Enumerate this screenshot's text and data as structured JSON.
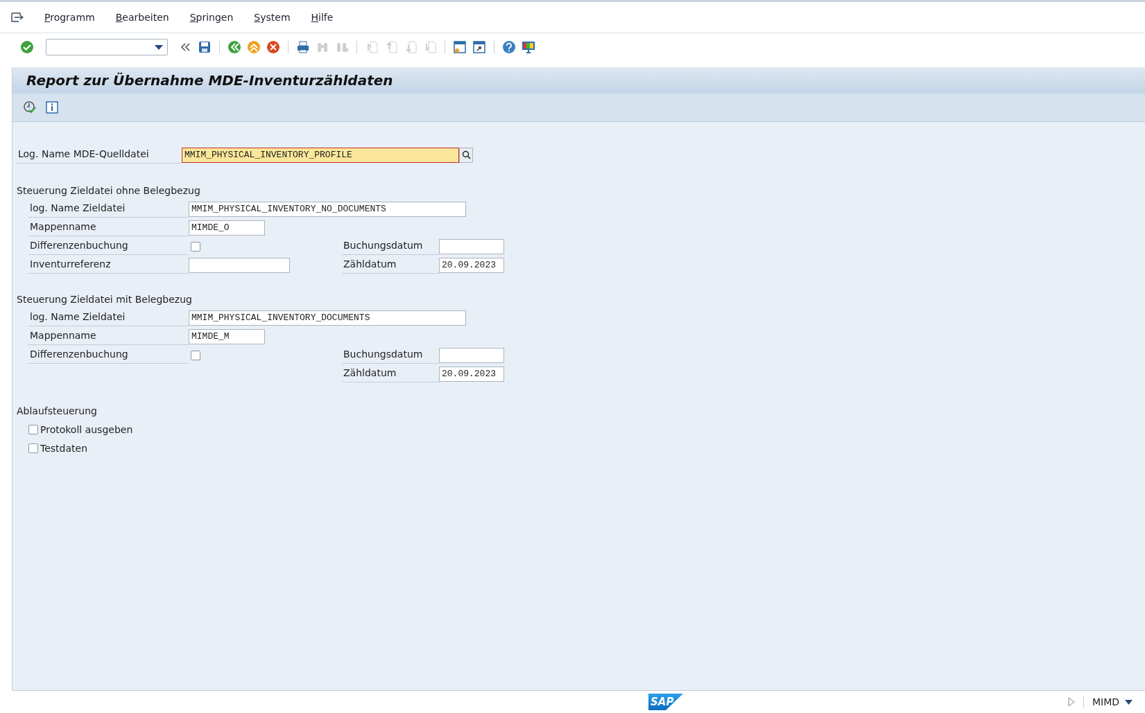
{
  "menu": [
    {
      "label": "Programm"
    },
    {
      "label": "Bearbeiten"
    },
    {
      "label": "Springen"
    },
    {
      "label": "System"
    },
    {
      "label": "Hilfe"
    }
  ],
  "toolbar": [
    {
      "kind": "enter",
      "disabled": false
    },
    {
      "kind": "command"
    },
    {
      "kind": "collapse",
      "disabled": false
    },
    {
      "kind": "save",
      "disabled": false
    },
    {
      "kind": "sep"
    },
    {
      "kind": "back",
      "disabled": false
    },
    {
      "kind": "exit",
      "disabled": false
    },
    {
      "kind": "cancel",
      "disabled": false
    },
    {
      "kind": "sep"
    },
    {
      "kind": "print",
      "disabled": false
    },
    {
      "kind": "find",
      "disabled": true
    },
    {
      "kind": "findnext",
      "disabled": true
    },
    {
      "kind": "sep"
    },
    {
      "kind": "first",
      "disabled": true
    },
    {
      "kind": "prev",
      "disabled": true
    },
    {
      "kind": "next",
      "disabled": true
    },
    {
      "kind": "last",
      "disabled": true
    },
    {
      "kind": "sep"
    },
    {
      "kind": "newsession",
      "disabled": false
    },
    {
      "kind": "shortcut",
      "disabled": false
    },
    {
      "kind": "sep"
    },
    {
      "kind": "help",
      "disabled": false
    },
    {
      "kind": "layout",
      "disabled": false
    }
  ],
  "title": "Report zur Übernahme MDE-Inventurzähldaten",
  "app_toolbar": [
    {
      "kind": "execute"
    },
    {
      "kind": "info"
    }
  ],
  "source": {
    "label": "Log. Name MDE-Quelldatei",
    "value": "MMIM_PHYSICAL_INVENTORY_PROFILE",
    "focused": true
  },
  "sections": [
    {
      "title": "Steuerung Zieldatei ohne Belegbezug",
      "rows": [
        {
          "left": {
            "kind": "longfield",
            "label": "log. Name Zieldatei",
            "value": "MMIM_PHYSICAL_INVENTORY_NO_DOCUMENTS"
          }
        },
        {
          "left": {
            "kind": "shortfield",
            "label": "Mappenname",
            "value": "MIMDE_O"
          }
        },
        {
          "left": {
            "kind": "checkbox",
            "label": "Differenzenbuchung",
            "checked": false
          },
          "right": {
            "label": "Buchungsdatum"
          }
        },
        {
          "left": {
            "kind": "mediumfield",
            "label": "Inventurreferenz"
          },
          "right": {
            "label": "Zähldatum",
            "value": "20.09.2023"
          }
        }
      ]
    },
    {
      "title": "Steuerung Zieldatei mit Belegbezug",
      "rows": [
        {
          "left": {
            "kind": "longfield",
            "label": "log. Name Zieldatei",
            "value": "MMIM_PHYSICAL_INVENTORY_DOCUMENTS"
          }
        },
        {
          "left": {
            "kind": "shortfield",
            "label": "Mappenname",
            "value": "MIMDE_M"
          }
        },
        {
          "left": {
            "kind": "checkbox",
            "label": "Differenzenbuchung",
            "checked": false
          },
          "right": {
            "label": "Buchungsdatum"
          }
        },
        {
          "right": {
            "label": "Zähldatum",
            "value": "20.09.2023"
          }
        }
      ]
    }
  ],
  "flow": {
    "title": "Ablaufsteuerung",
    "options": [
      {
        "label": "Protokoll ausgeben",
        "checked": false
      },
      {
        "label": "Testdaten",
        "checked": false
      }
    ]
  },
  "status_bar": {
    "logo": "SAP",
    "system": "MIMD"
  }
}
